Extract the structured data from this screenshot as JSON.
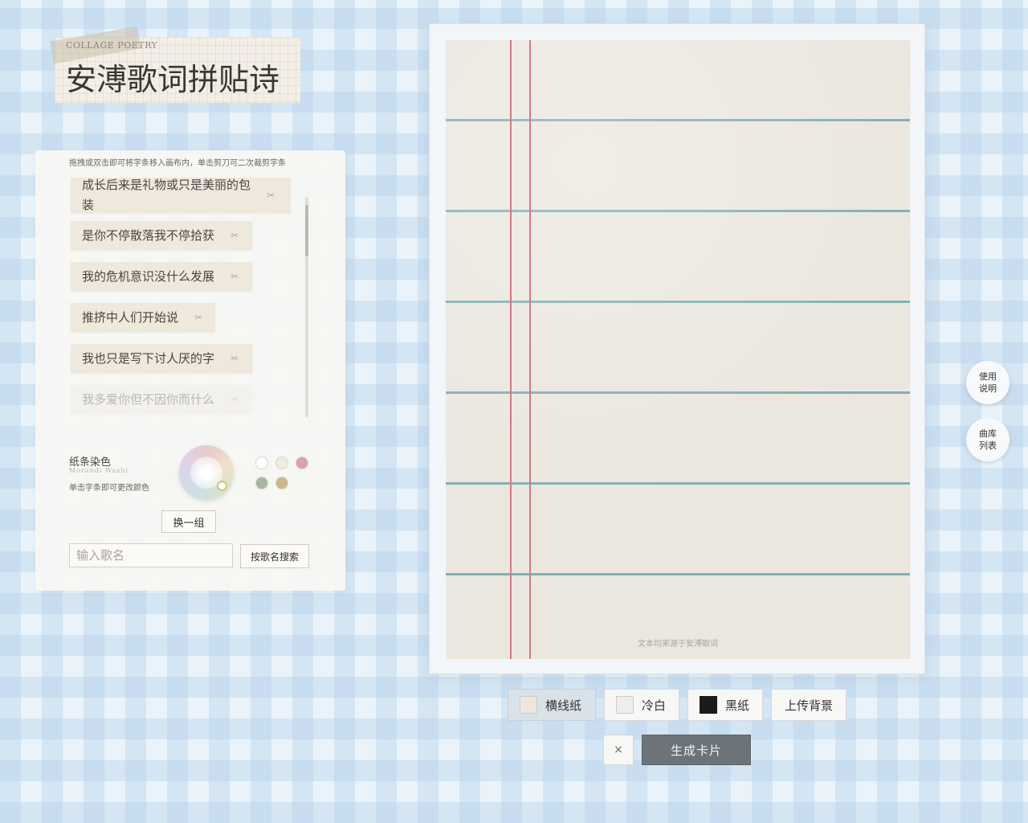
{
  "title": {
    "small": "COLLAGE POETRY",
    "main": "安溥歌词拼贴诗"
  },
  "panel": {
    "hint": "拖拽或双击即可将字条移入画布内，单击剪刀可二次裁剪字条",
    "strips": [
      "成长后来是礼物或只是美丽的包装",
      "是你不停散落我不停拾获",
      "我的危机意识没什么发展",
      "推挤中人们开始说",
      "我也只是写下讨人厌的字",
      "我多爱你但不因你而什么"
    ],
    "scissors_icon": "scissors-icon",
    "dye": {
      "title": "纸条染色",
      "subtitle": "Morandi Washi",
      "hint": "单击字条即可更改颜色"
    },
    "swatches": [
      "#ffffff",
      "#f0ebe0",
      "#d9a3ab",
      "#a8b5a3",
      "#c9b88a"
    ],
    "swap_label": "换一组",
    "search_placeholder": "输入歌名",
    "search_button": "按歌名搜索"
  },
  "canvas": {
    "credit": "文本均来源于安溥歌词"
  },
  "side": {
    "help": [
      "使用",
      "说明"
    ],
    "library": [
      "曲库",
      "列表"
    ]
  },
  "toolbar": {
    "paper_options": [
      {
        "label": "横线纸",
        "color": "#ece6dc",
        "active": true
      },
      {
        "label": "冷白",
        "color": "#eeeeee",
        "active": false
      },
      {
        "label": "黑纸",
        "color": "#1b1b1b",
        "active": false
      }
    ],
    "upload_label": "上传背景",
    "close_label": "×",
    "generate_label": "生成卡片"
  }
}
